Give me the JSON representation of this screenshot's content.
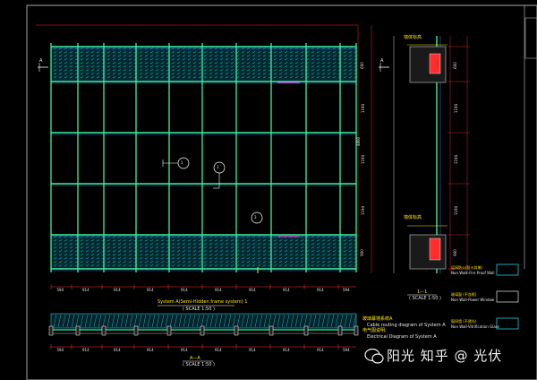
{
  "elevation": {
    "dim_top": [
      "600",
      "1194",
      "1194",
      "1194",
      "900"
    ],
    "dim_bottom": [
      "594",
      "914",
      "914",
      "914",
      "914",
      "914",
      "914",
      "914",
      "914",
      "594"
    ],
    "dim_right": [
      "600",
      "1194",
      "1194",
      "1194",
      "900"
    ],
    "dim_total": "4800",
    "section_marker": "A",
    "title_cn": "System A(Semi-Hidden frame system) 1",
    "scale": "( SCALE 1:50 )",
    "callouts": [
      "1",
      "2",
      "3"
    ]
  },
  "plan_section": {
    "title": "A—A",
    "scale": "( SCALE 1:50 )",
    "dims": [
      "594",
      "914",
      "914",
      "914",
      "914",
      "914",
      "914",
      "914",
      "914",
      "594"
    ]
  },
  "side_section": {
    "title": "1—1",
    "scale": "( SCALE 1:50 )",
    "label_top": "墙体标高",
    "label_bottom": "墙体标高"
  },
  "notes": {
    "line1": "玻璃幕墙系统A",
    "line2": "Cable routing diagram of System A",
    "line3": "电气图说明:",
    "line4": "Electrical Diagram of System A"
  },
  "legend": [
    {
      "cn": "层间防火(防火封堵)",
      "en": "Non Walk-Fire Proof Wall"
    },
    {
      "cn": "玻璃窗 (不含框)",
      "en": "Non Wall-Power Window"
    },
    {
      "cn": "窗间墙 (不透光)",
      "en": "Non Wall-Vitrification Glass"
    }
  ],
  "watermark": "阳光 知乎 @ 光伏",
  "colors": {
    "grid": "#3df0a0",
    "panel_line": "#18d0e0",
    "hatch": "#18b8c8",
    "dim": "#ffe600",
    "text": "#ffffff",
    "magenta": "#ff40ff"
  }
}
